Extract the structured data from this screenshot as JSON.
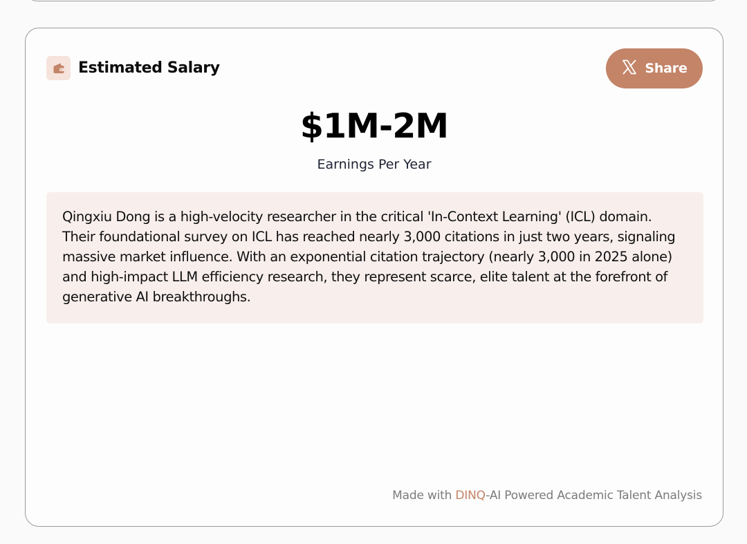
{
  "salary_card": {
    "title": "Estimated Salary",
    "title_icon": "wallet-icon",
    "share_button": {
      "label": "Share",
      "icon": "x-logo-icon"
    },
    "salary_range": "$1M-2M",
    "salary_caption": "Earnings Per Year",
    "summary": "Qingxiu Dong is a high-velocity researcher in the critical 'In-Context Learning' (ICL) domain. Their foundational survey on ICL has reached nearly 3,000 citations in just two years, signaling massive market influence. With an exponential citation trajectory (nearly 3,000 in 2025 alone) and high-impact LLM efficiency research, they represent scarce, elite talent at the forefront of generative AI breakthroughs.",
    "footer": {
      "prefix": "Made with ",
      "brand": "DINQ",
      "suffix": "-AI Powered Academic Talent Analysis"
    }
  },
  "colors": {
    "accent": "#c38468",
    "summary_bg": "#f8efed",
    "icon_tile_bg": "#f5e3dc",
    "card_border": "#9a9a9a",
    "footer_text": "#7b7b7b"
  }
}
